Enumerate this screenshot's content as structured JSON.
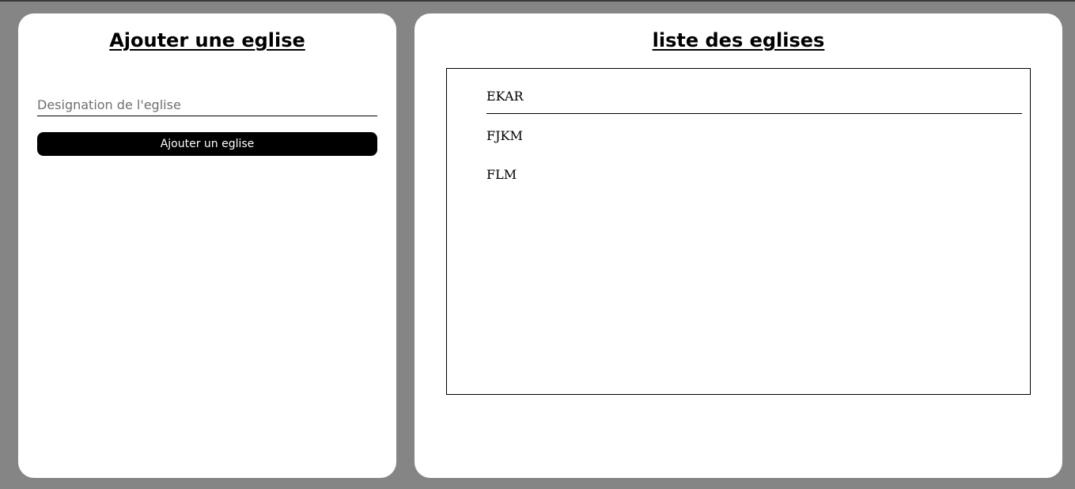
{
  "add_panel": {
    "title": "Ajouter une eglise",
    "designation_placeholder": "Designation de l'eglise",
    "designation_value": "",
    "add_button_label": "Ajouter un eglise"
  },
  "list_panel": {
    "title": "liste des eglises",
    "items": [
      {
        "label": "EKAR"
      },
      {
        "label": "FJKM"
      },
      {
        "label": "FLM"
      }
    ]
  }
}
